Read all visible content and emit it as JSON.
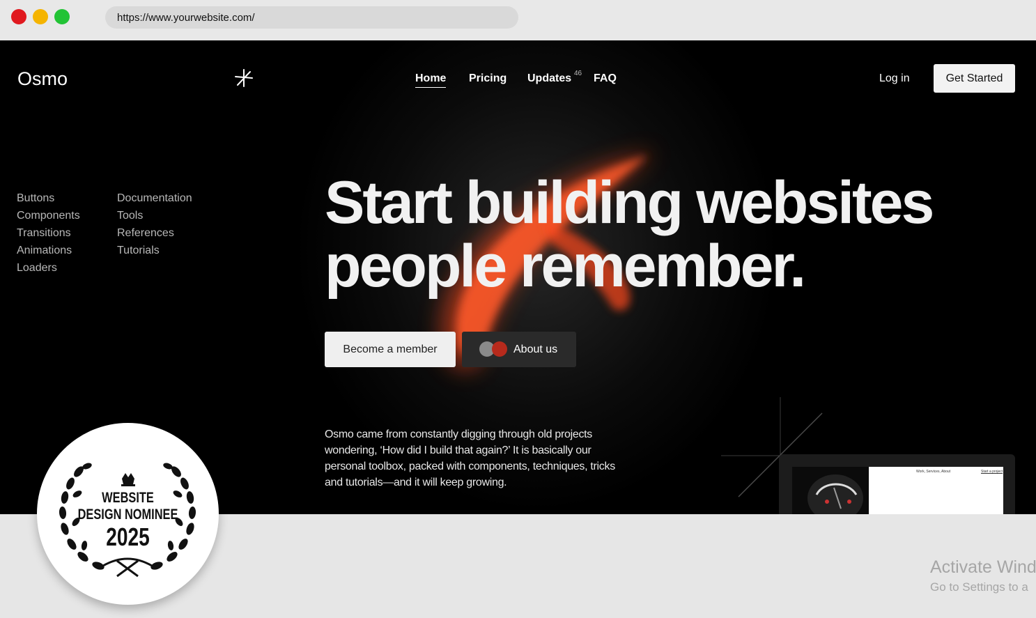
{
  "browser": {
    "url": "https://www.yourwebsite.com/"
  },
  "site": {
    "logo": "Osmo",
    "nav": {
      "home": "Home",
      "pricing": "Pricing",
      "updates": "Updates",
      "updates_count": "46",
      "faq": "FAQ"
    },
    "login": "Log in",
    "cta": "Get Started"
  },
  "sidebar": {
    "col1": [
      "Buttons",
      "Components",
      "Transitions",
      "Animations",
      "Loaders"
    ],
    "col2": [
      "Documentation",
      "Tools",
      "References",
      "Tutorials"
    ]
  },
  "hero": {
    "line1": "Start building websites",
    "line2": "people remember.",
    "member_button": "Become a member",
    "about_button": "About us",
    "description": "Osmo came from constantly digging through old projects wondering, ‘How did I build that again?’ It is basically our personal toolbox, packed with components, techniques, tricks and tutorials—and it will keep growing."
  },
  "preview": {
    "nav_text": "Work, Services, About",
    "cta_text": "Start a project"
  },
  "award": {
    "line1": "WEBSITE",
    "line2": "DESIGN NOMINEE",
    "year": "2025"
  },
  "os_overlay": {
    "title": "Activate Wind",
    "subtitle": "Go to Settings to a"
  },
  "colors": {
    "accent": "#ff4a1c",
    "background": "#000000",
    "chrome": "#e8e8e8"
  }
}
